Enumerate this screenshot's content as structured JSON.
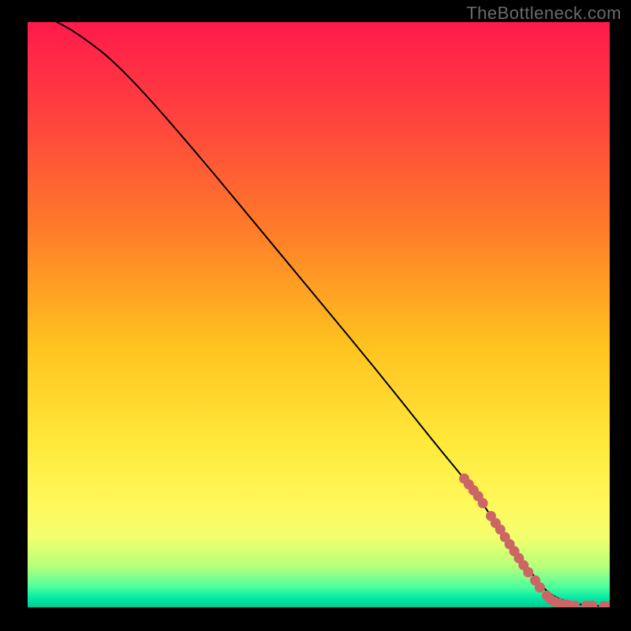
{
  "watermark": "TheBottleneck.com",
  "chart_data": {
    "type": "line",
    "title": "",
    "xlabel": "",
    "ylabel": "",
    "xlim": [
      0,
      100
    ],
    "ylim": [
      0,
      100
    ],
    "grid": false,
    "legend": false,
    "note": "Axes, ticks and labels are not visible in the image; x/y are normalized 0–100. Curve descends from top-left and flattens near y≈0 at the right.",
    "curve": {
      "name": "bottleneck-curve",
      "x": [
        5,
        7,
        10,
        14,
        20,
        30,
        40,
        50,
        60,
        70,
        75,
        78,
        80,
        82,
        85,
        88,
        90,
        93,
        96,
        100
      ],
      "y": [
        100,
        99,
        97,
        94,
        88,
        76.5,
        64.5,
        52.5,
        40.5,
        28,
        22,
        18,
        15,
        12,
        8,
        4,
        2,
        0.8,
        0.3,
        0.2
      ]
    },
    "markers": {
      "name": "highlighted-segment",
      "color": "#cc6666",
      "x": [
        75.0,
        75.8,
        76.6,
        77.4,
        78.2,
        79.6,
        80.4,
        81.2,
        82.0,
        82.8,
        83.6,
        84.4,
        85.2,
        86.0,
        87.2,
        88.0,
        89.2,
        89.8,
        90.5,
        91.3,
        92.4,
        93.0,
        94.0,
        96.0,
        97.0,
        99.0,
        100.0
      ],
      "y": [
        22.0,
        21.0,
        20.0,
        19.0,
        17.8,
        15.6,
        14.4,
        13.3,
        12.0,
        10.8,
        9.6,
        8.4,
        7.2,
        6.0,
        4.6,
        3.4,
        2.0,
        1.4,
        1.0,
        0.7,
        0.5,
        0.4,
        0.3,
        0.3,
        0.3,
        0.2,
        0.2
      ]
    },
    "gradient_bands": [
      {
        "stop": 0.0,
        "color": "#ff1a4b"
      },
      {
        "stop": 0.15,
        "color": "#ff3f3f"
      },
      {
        "stop": 0.35,
        "color": "#ff7a2a"
      },
      {
        "stop": 0.55,
        "color": "#ffc21f"
      },
      {
        "stop": 0.72,
        "color": "#ffe93a"
      },
      {
        "stop": 0.82,
        "color": "#fff85a"
      },
      {
        "stop": 0.88,
        "color": "#f3ff6e"
      },
      {
        "stop": 0.93,
        "color": "#b7ff7a"
      },
      {
        "stop": 0.965,
        "color": "#4dff9e"
      },
      {
        "stop": 0.985,
        "color": "#00e8a6"
      },
      {
        "stop": 1.0,
        "color": "#00c98e"
      }
    ]
  }
}
